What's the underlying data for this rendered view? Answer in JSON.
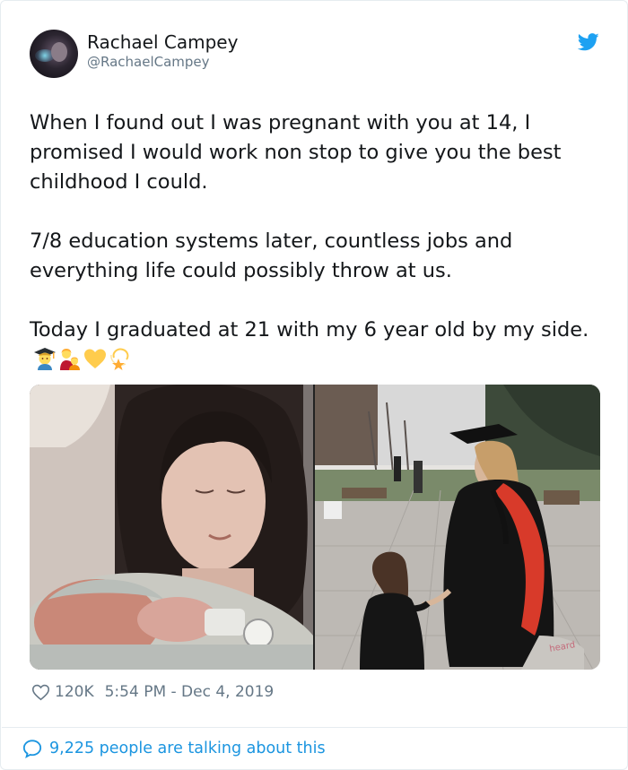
{
  "tweet": {
    "author_name": "Rachael Campey",
    "author_handle": "@RachaelCampey",
    "paragraph_1": "When I found out I was pregnant with you at 14, I promised I would work non stop to give you the best childhood I could.",
    "paragraph_2": "7/8 education systems later, countless jobs and everything life could possibly throw at us.",
    "paragraph_3": "Today I graduated at 21 with my 6 year old by my side.",
    "emojis": [
      "graduate-emoji",
      "mother-daughter-emoji",
      "yellow-heart-emoji",
      "dizzy-star-emoji"
    ],
    "likes": "120K",
    "timestamp": "5:54 PM - Dec 4, 2019",
    "talking_text": "9,225 people are talking about this"
  },
  "media": {
    "left_photo": "newborn-with-mother-photo",
    "right_photo": "graduation-with-daughter-photo"
  },
  "colors": {
    "twitter_blue": "#1da1f2",
    "link_blue": "#1b95e0",
    "muted_text": "#657786",
    "body_text": "#14171a",
    "border": "#e6ecf0"
  }
}
